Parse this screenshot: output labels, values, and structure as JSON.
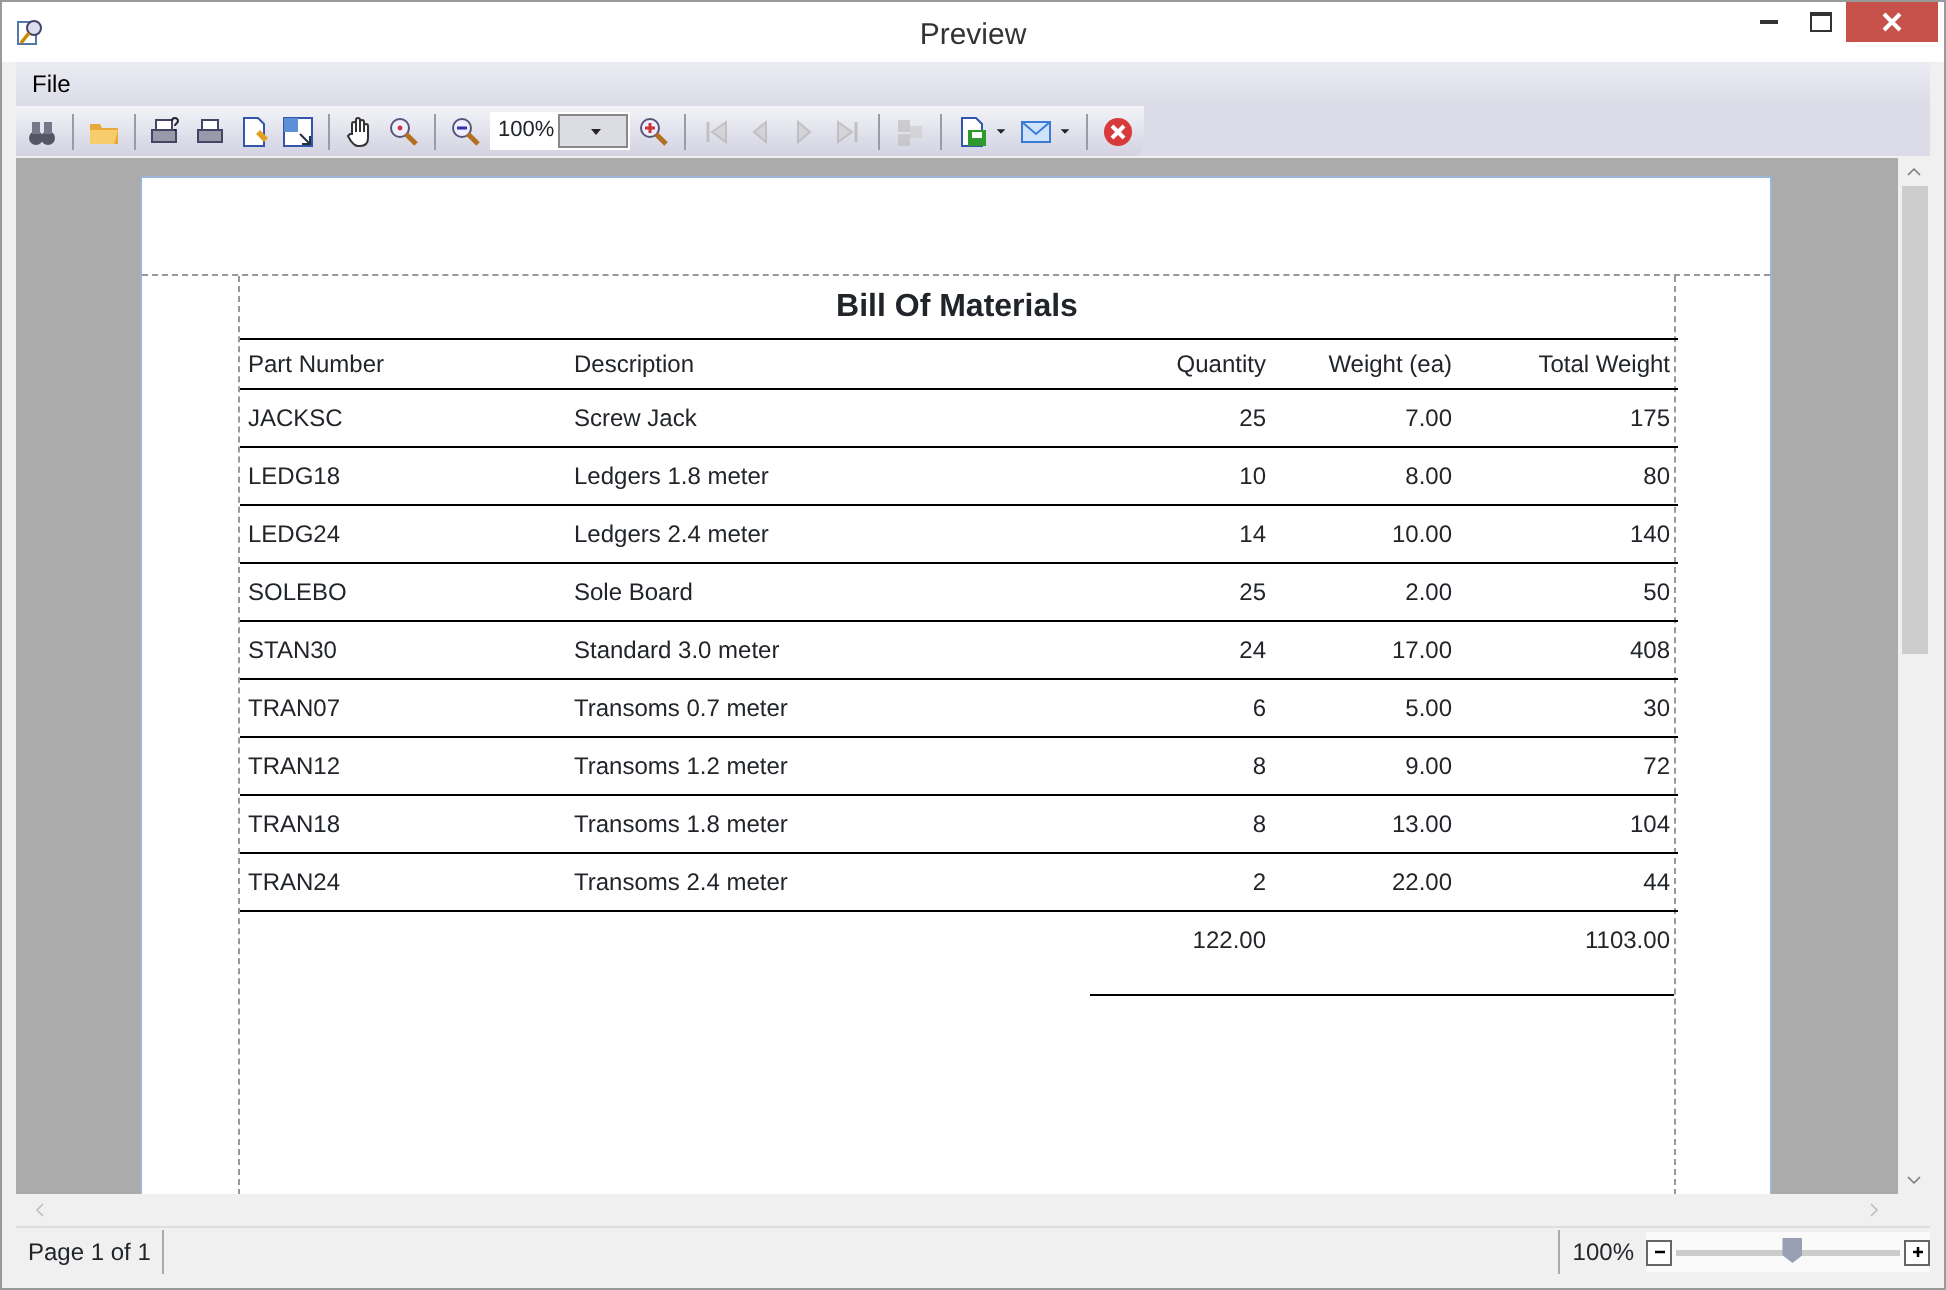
{
  "window": {
    "title": "Preview"
  },
  "menu": [
    {
      "label": "File"
    }
  ],
  "toolbar": [
    {
      "kind": "find",
      "disabled": false
    },
    {
      "kind": "sep"
    },
    {
      "kind": "open",
      "disabled": false
    },
    {
      "kind": "sep"
    },
    {
      "kind": "print-setup",
      "disabled": false
    },
    {
      "kind": "print",
      "disabled": false
    },
    {
      "kind": "page-setup",
      "disabled": false
    },
    {
      "kind": "resize",
      "disabled": false
    },
    {
      "kind": "sep"
    },
    {
      "kind": "hand",
      "disabled": false
    },
    {
      "kind": "zoom",
      "disabled": false
    },
    {
      "kind": "sep"
    },
    {
      "kind": "zoom-out",
      "disabled": false
    },
    {
      "kind": "combo",
      "value": "100%"
    },
    {
      "kind": "zoom-in",
      "disabled": false
    },
    {
      "kind": "sep"
    },
    {
      "kind": "first",
      "disabled": true
    },
    {
      "kind": "prev",
      "disabled": true
    },
    {
      "kind": "next",
      "disabled": true
    },
    {
      "kind": "last",
      "disabled": true
    },
    {
      "kind": "sep"
    },
    {
      "kind": "pages",
      "disabled": true
    },
    {
      "kind": "sep"
    },
    {
      "kind": "save",
      "disabled": false,
      "dropdown": true
    },
    {
      "kind": "email",
      "disabled": false,
      "dropdown": true
    },
    {
      "kind": "sep"
    },
    {
      "kind": "close",
      "disabled": false
    }
  ],
  "report": {
    "title": "Bill Of Materials",
    "columns": [
      "Part Number",
      "Description",
      "Quantity",
      "Weight (ea)",
      "Total Weight"
    ],
    "rows": [
      [
        "JACKSC",
        "Screw Jack",
        "25",
        "7.00",
        "175"
      ],
      [
        "LEDG18",
        "Ledgers 1.8 meter",
        "10",
        "8.00",
        "80"
      ],
      [
        "LEDG24",
        "Ledgers 2.4 meter",
        "14",
        "10.00",
        "140"
      ],
      [
        "SOLEBO",
        "Sole Board",
        "25",
        "2.00",
        "50"
      ],
      [
        "STAN30",
        "Standard 3.0 meter",
        "24",
        "17.00",
        "408"
      ],
      [
        "TRAN07",
        "Transoms 0.7 meter",
        "6",
        "5.00",
        "30"
      ],
      [
        "TRAN12",
        "Transoms 1.2 meter",
        "8",
        "9.00",
        "72"
      ],
      [
        "TRAN18",
        "Transoms 1.8 meter",
        "8",
        "13.00",
        "104"
      ],
      [
        "TRAN24",
        "Transoms 2.4 meter",
        "2",
        "22.00",
        "44"
      ]
    ],
    "totals": {
      "quantity": "122.00",
      "total_weight": "1103.00"
    }
  },
  "status_bar": {
    "page": "Page 1 of 1",
    "zoom": "100%",
    "zoom_slider": {
      "level": 0.52
    }
  }
}
